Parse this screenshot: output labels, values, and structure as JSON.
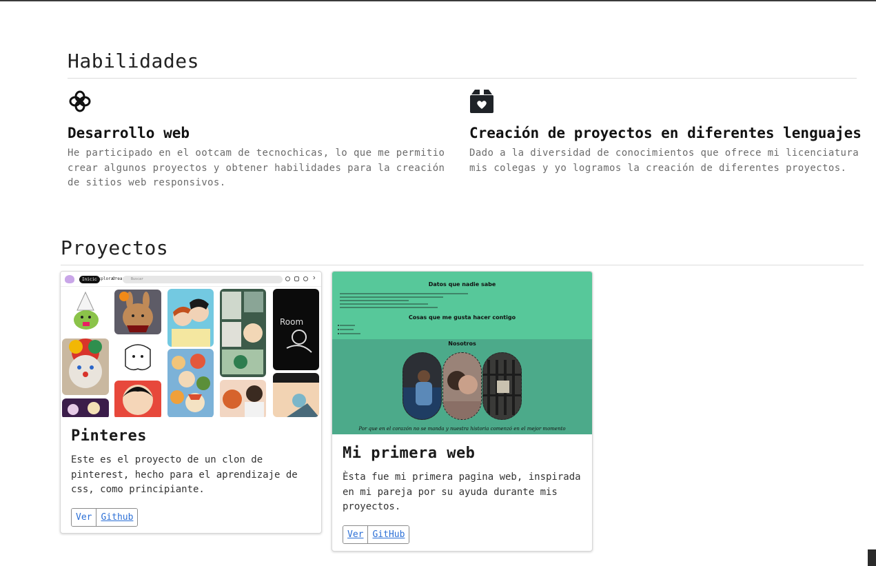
{
  "skills": {
    "title": "Habilidades",
    "items": [
      {
        "icon": "atom-flower-icon",
        "heading": "Desarrollo web",
        "text": "He participado en el ootcam de tecnochicas, lo que me permitio crear algunos proyectos y obtener habilidades para la creación de sitios web responsivos."
      },
      {
        "icon": "heart-box-icon",
        "heading": "Creación de proyectos en diferentes lenguajes",
        "text": "Dado a la diversidad de conocimientos que ofrece mi licenciatura mis colegas y yo logramos la creación de diferentes proyectos."
      }
    ]
  },
  "projects": {
    "title": "Proyectos",
    "cards": [
      {
        "title": "Pinteres",
        "text": "Este es el proyecto de un clon de pinterest, hecho para el aprendizaje de css, como principiante.",
        "buttons": [
          "Ver",
          "Github"
        ],
        "thumb": {
          "nav_pill": "Inicio",
          "nav_links": [
            "Explorar",
            "Crear"
          ],
          "search_placeholder": "Buscar"
        }
      },
      {
        "title": "Mi primera web",
        "text": "Èsta fue mi primera pagina web, inspirada en mi pareja por su ayuda durante mis proyectos.",
        "buttons": [
          "Ver",
          "GitHub"
        ],
        "thumb": {
          "heading_1": "Datos que nadie sabe",
          "heading_2": "Cosas que me gusta hacer contigo",
          "heading_3": "Nosotros",
          "footer": "Por que en el corazón no se manda y nuestra historia comenzó en el mejor momento"
        }
      }
    ]
  },
  "colors": {
    "link": "#2b6fd6",
    "muted_text": "#6b6b6b",
    "web_green": "#57c89a"
  }
}
